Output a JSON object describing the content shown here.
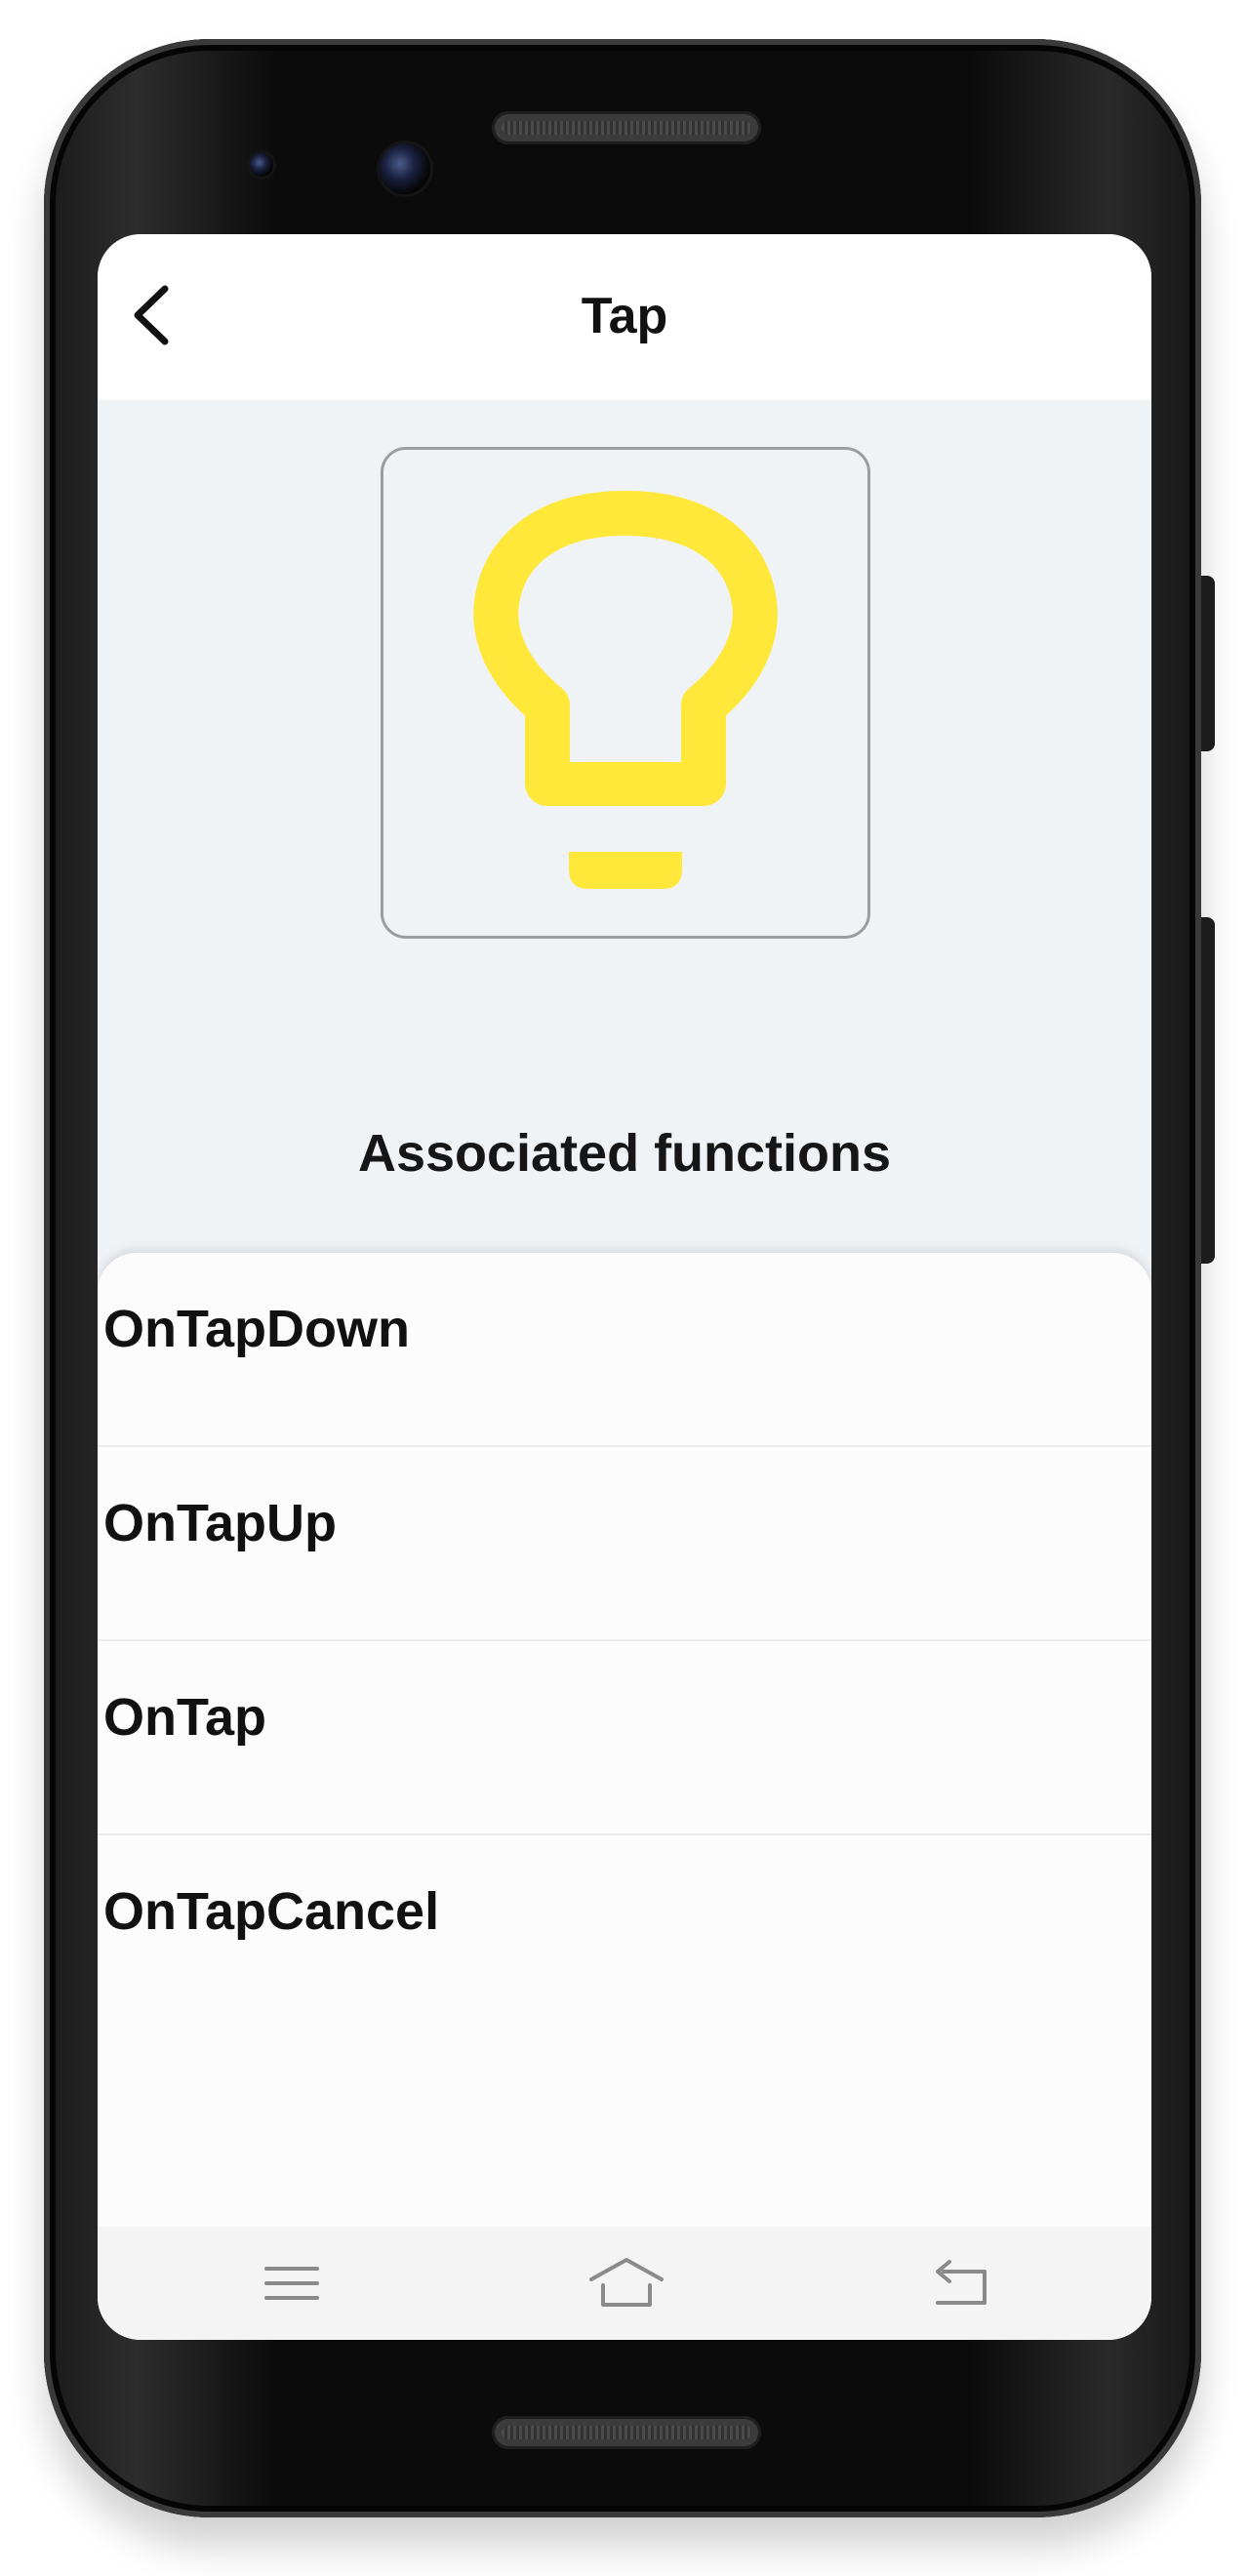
{
  "header": {
    "title": "Tap"
  },
  "hero": {
    "icon": "lightbulb-icon",
    "icon_color": "#ffe83a"
  },
  "section": {
    "heading": "Associated functions"
  },
  "functions": [
    {
      "label": "OnTapDown"
    },
    {
      "label": "OnTapUp"
    },
    {
      "label": "OnTap"
    },
    {
      "label": "OnTapCancel"
    }
  ],
  "nav": {
    "icons": [
      "menu-icon",
      "home-icon",
      "back-icon"
    ]
  },
  "colors": {
    "screen_background": "#f0f3f6",
    "sheet_background": "#fcfcfc",
    "text": "#111111"
  }
}
